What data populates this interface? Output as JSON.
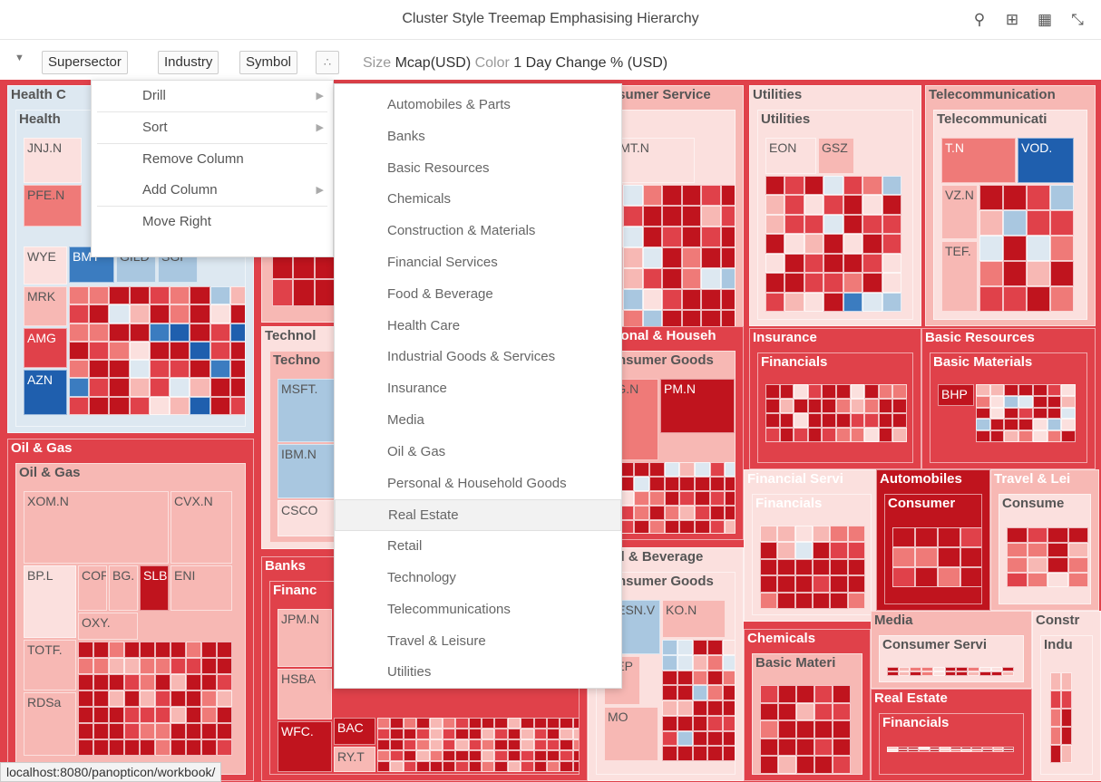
{
  "title": "Cluster Style Treemap Emphasising Hierarchy",
  "toolbar_icons": [
    {
      "name": "search-icon",
      "glyph": "⚲"
    },
    {
      "name": "export-excel-icon",
      "glyph": "⊞"
    },
    {
      "name": "table-view-icon",
      "glyph": "▦"
    },
    {
      "name": "collapse-icon",
      "glyph": "⤡"
    }
  ],
  "filters": {
    "chips": [
      "Supersector",
      "Industry",
      "Symbol"
    ],
    "size_label": "Size",
    "size_value": "Mcap(USD)",
    "color_label": "Color",
    "color_value": "1 Day Change % (USD)"
  },
  "context_menu": {
    "items": [
      {
        "label": "Drill",
        "has_submenu": true
      },
      {
        "label": "Sort",
        "has_submenu": true
      },
      {
        "label": "Remove Column",
        "has_submenu": false
      },
      {
        "label": "Add Column",
        "has_submenu": true
      },
      {
        "label": "Move Right",
        "has_submenu": false
      }
    ]
  },
  "submenu": {
    "items": [
      "Automobiles & Parts",
      "Banks",
      "Basic Resources",
      "Chemicals",
      "Construction & Materials",
      "Financial Services",
      "Food & Beverage",
      "Health Care",
      "Industrial Goods & Services",
      "Insurance",
      "Media",
      "Oil & Gas",
      "Personal & Household Goods",
      "Real Estate",
      "Retail",
      "Technology",
      "Telecommunications",
      "Travel & Leisure",
      "Utilities"
    ],
    "highlighted": "Real Estate"
  },
  "treemap": {
    "groups": [
      {
        "label": "Health C",
        "sub": "Health",
        "leaves": [
          "JNJ.N",
          "PFE.N",
          "WYE",
          "BMY",
          "GILD",
          "SGP",
          "MRK",
          "AMG",
          "AZN"
        ]
      },
      {
        "label": "Oil & Gas",
        "sub": "Oil & Gas",
        "leaves": [
          "XOM.N",
          "CVX.N",
          "BP.L",
          "COP",
          "BG.",
          "SLB",
          "ENI",
          "OXY.",
          "TOTF.",
          "RDSa"
        ]
      },
      {
        "label": "Technol",
        "sub": "Techno",
        "leaves": [
          "MSFT.",
          "IBM.N",
          "CSCO"
        ]
      },
      {
        "label": "Banks",
        "sub": "Financ",
        "leaves": [
          "JPM.N",
          "HSBA",
          "BAC",
          "WFC.",
          "RY.T"
        ]
      },
      {
        "label": "Consumer Service",
        "sub": "",
        "leaves": [
          "WMT.N"
        ]
      },
      {
        "label": "Personal & Househ",
        "sub": "Consumer Goods",
        "leaves": [
          "PG.N",
          "PM.N"
        ]
      },
      {
        "label": "Food & Beverage",
        "sub": "Consumer Goods",
        "leaves": [
          "NESN.V",
          "KO.N",
          "PEP",
          "MO"
        ]
      },
      {
        "label": "Utilities",
        "sub": "Utilities",
        "leaves": [
          "EON",
          "GSZ"
        ]
      },
      {
        "label": "Telecommunication",
        "sub": "Telecommunicati",
        "leaves": [
          "T.N",
          "VOD.",
          "VZ.N",
          "TEF."
        ]
      },
      {
        "label": "Insurance",
        "sub": "Financials",
        "leaves": []
      },
      {
        "label": "Basic Resources",
        "sub": "Basic Materials",
        "leaves": [
          "BHP"
        ]
      },
      {
        "label": "Financial Servi",
        "sub": "Financials",
        "leaves": []
      },
      {
        "label": "Automobiles",
        "sub": "Consumer",
        "leaves": []
      },
      {
        "label": "Travel & Lei",
        "sub": "Consume",
        "leaves": []
      },
      {
        "label": "Media",
        "sub": "Consumer Servi",
        "leaves": []
      },
      {
        "label": "Constr",
        "sub": "Indu",
        "leaves": []
      },
      {
        "label": "Chemicals",
        "sub": "Basic Materi",
        "leaves": []
      },
      {
        "label": "Real Estate",
        "sub": "Financials",
        "leaves": []
      }
    ]
  },
  "status_url": "localhost:8080/panopticon/workbook/",
  "colors": {
    "strong_red": "#c0141e",
    "red": "#e0414a",
    "mid_red": "#ef7a78",
    "light_red": "#f7b8b4",
    "pale_red": "#fbe0de",
    "pale_blue": "#dde8f1",
    "light_blue": "#a9c7e0",
    "blue": "#3b7cc0",
    "dark_blue": "#1f5fae"
  }
}
